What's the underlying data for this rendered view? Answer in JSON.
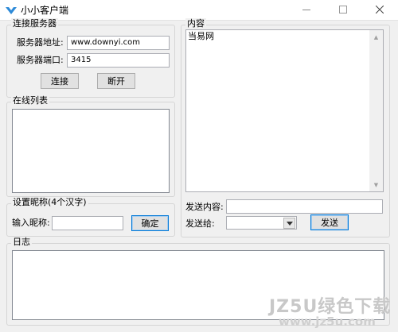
{
  "window": {
    "title": "小小客户端"
  },
  "connect": {
    "group_label": "连接服务器",
    "address_label": "服务器地址:",
    "address_value": "www.downyi.com",
    "port_label": "服务器端口:",
    "port_value": "3415",
    "connect_button": "连接",
    "disconnect_button": "断开"
  },
  "online": {
    "group_label": "在线列表"
  },
  "nickname": {
    "group_label": "设置昵称(4个汉字)",
    "input_label": "输入昵称:",
    "input_value": "",
    "confirm_button": "确定"
  },
  "content": {
    "group_label": "内容",
    "text": "当易网",
    "send_content_label": "发送内容:",
    "send_content_value": "",
    "send_to_label": "发送给:",
    "send_to_value": "",
    "send_button": "发送"
  },
  "log": {
    "group_label": "日志"
  },
  "watermark": {
    "line1": "JZ5U绿色下载",
    "line2": "www.jz5u.com"
  },
  "icons": {
    "app": "app-logo-icon",
    "minimize": "minimize-icon",
    "maximize": "maximize-icon",
    "close": "close-icon",
    "scroll_up": "scroll-up-arrow-icon",
    "scroll_down": "scroll-down-arrow-icon",
    "dropdown": "chevron-down-icon"
  },
  "colors": {
    "default_button_border": "#0078d7",
    "window_bg": "#f0f0f0",
    "watermark": "#c8c8c8"
  }
}
